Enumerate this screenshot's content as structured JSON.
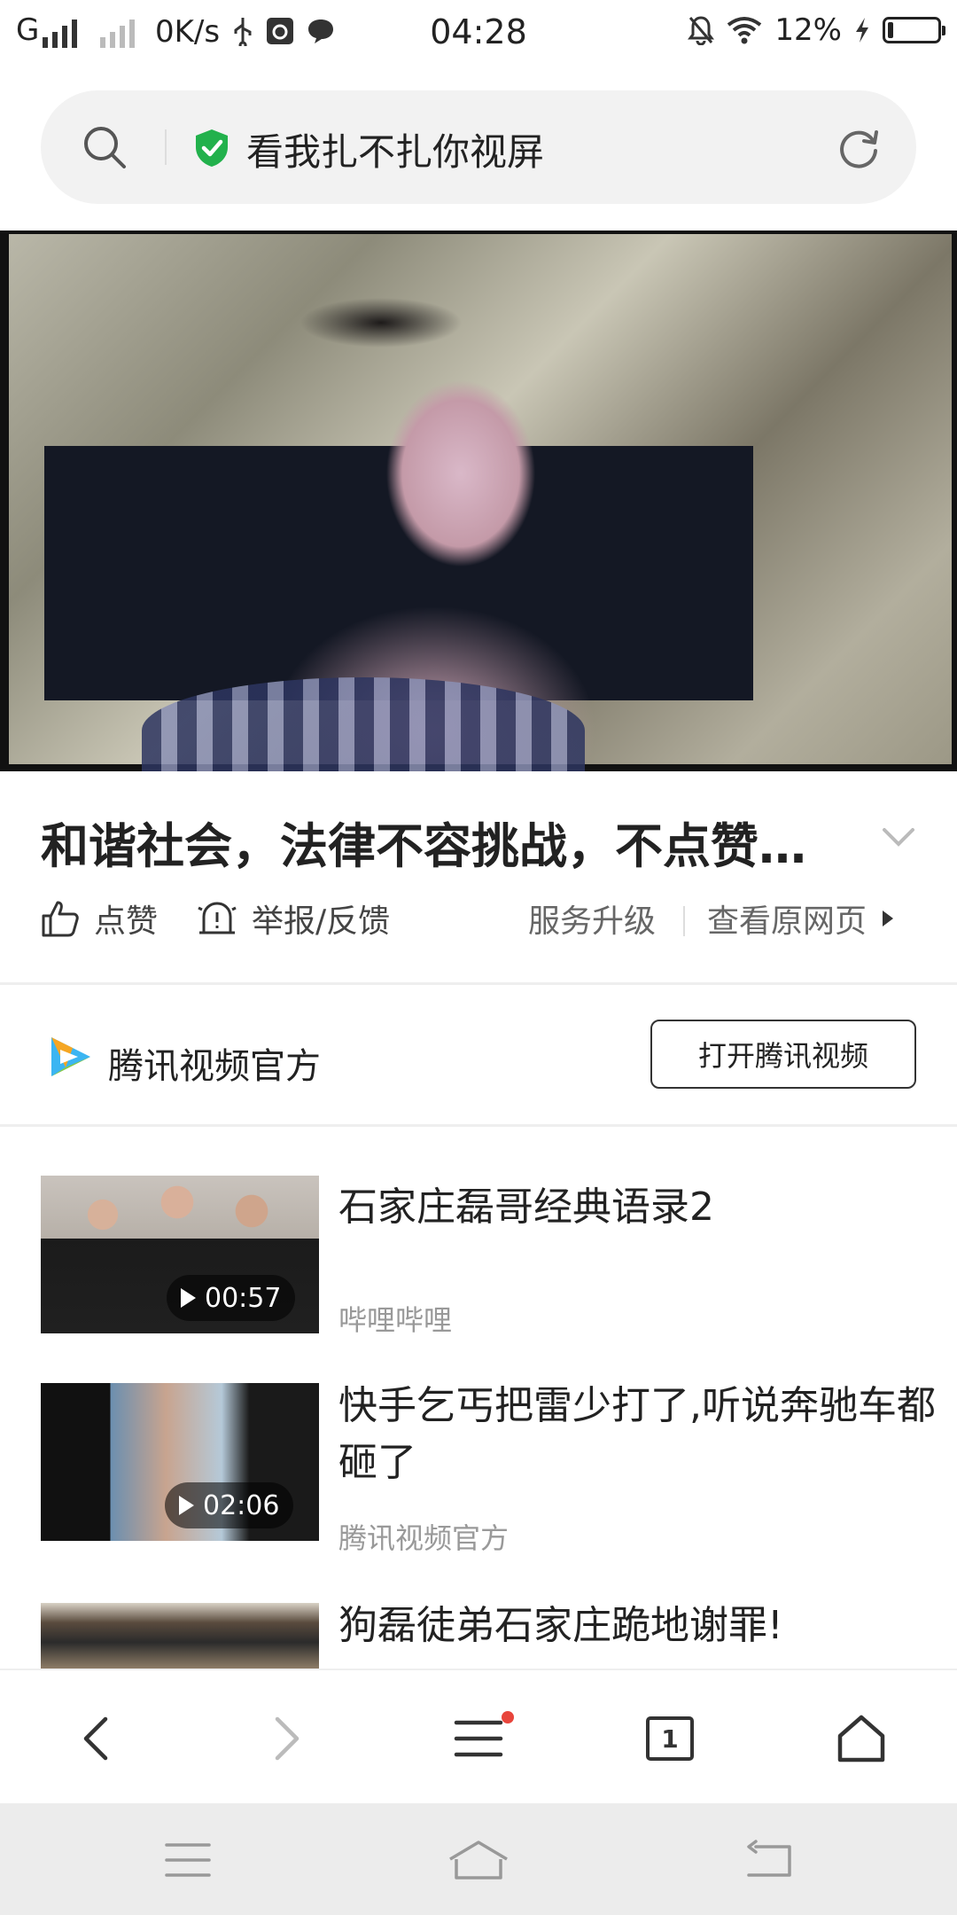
{
  "status_bar": {
    "network": "G",
    "speed": "0K/s",
    "time": "04:28",
    "battery": "12%",
    "battery_level": 0.12
  },
  "address_bar": {
    "title": "看我扎不扎你视屏"
  },
  "article": {
    "title": "和谐社会，法律不容挑战，不点赞…",
    "like_label": "点赞",
    "report_label": "举报/反馈",
    "upgrade_label": "服务升级",
    "original_label": "查看原网页"
  },
  "source": {
    "name": "腾讯视频官方",
    "open_label": "打开腾讯视频"
  },
  "related": [
    {
      "title": "石家庄磊哥经典语录2",
      "source": "哔哩哔哩",
      "duration": "00:57"
    },
    {
      "title": "快手乞丐把雷少打了,听说奔驰车都砸了",
      "source": "腾讯视频官方",
      "duration": "02:06"
    },
    {
      "title": "狗磊徒弟石家庄跪地谢罪!",
      "source": "",
      "duration": ""
    }
  ],
  "toolbar": {
    "tab_count": "1",
    "icons": [
      "back-icon",
      "forward-icon",
      "menu-icon",
      "tabs-icon",
      "home-icon"
    ]
  },
  "colors": {
    "shield": "#22b14c",
    "notification_dot": "#e8453c",
    "muted_text": "#999999"
  }
}
